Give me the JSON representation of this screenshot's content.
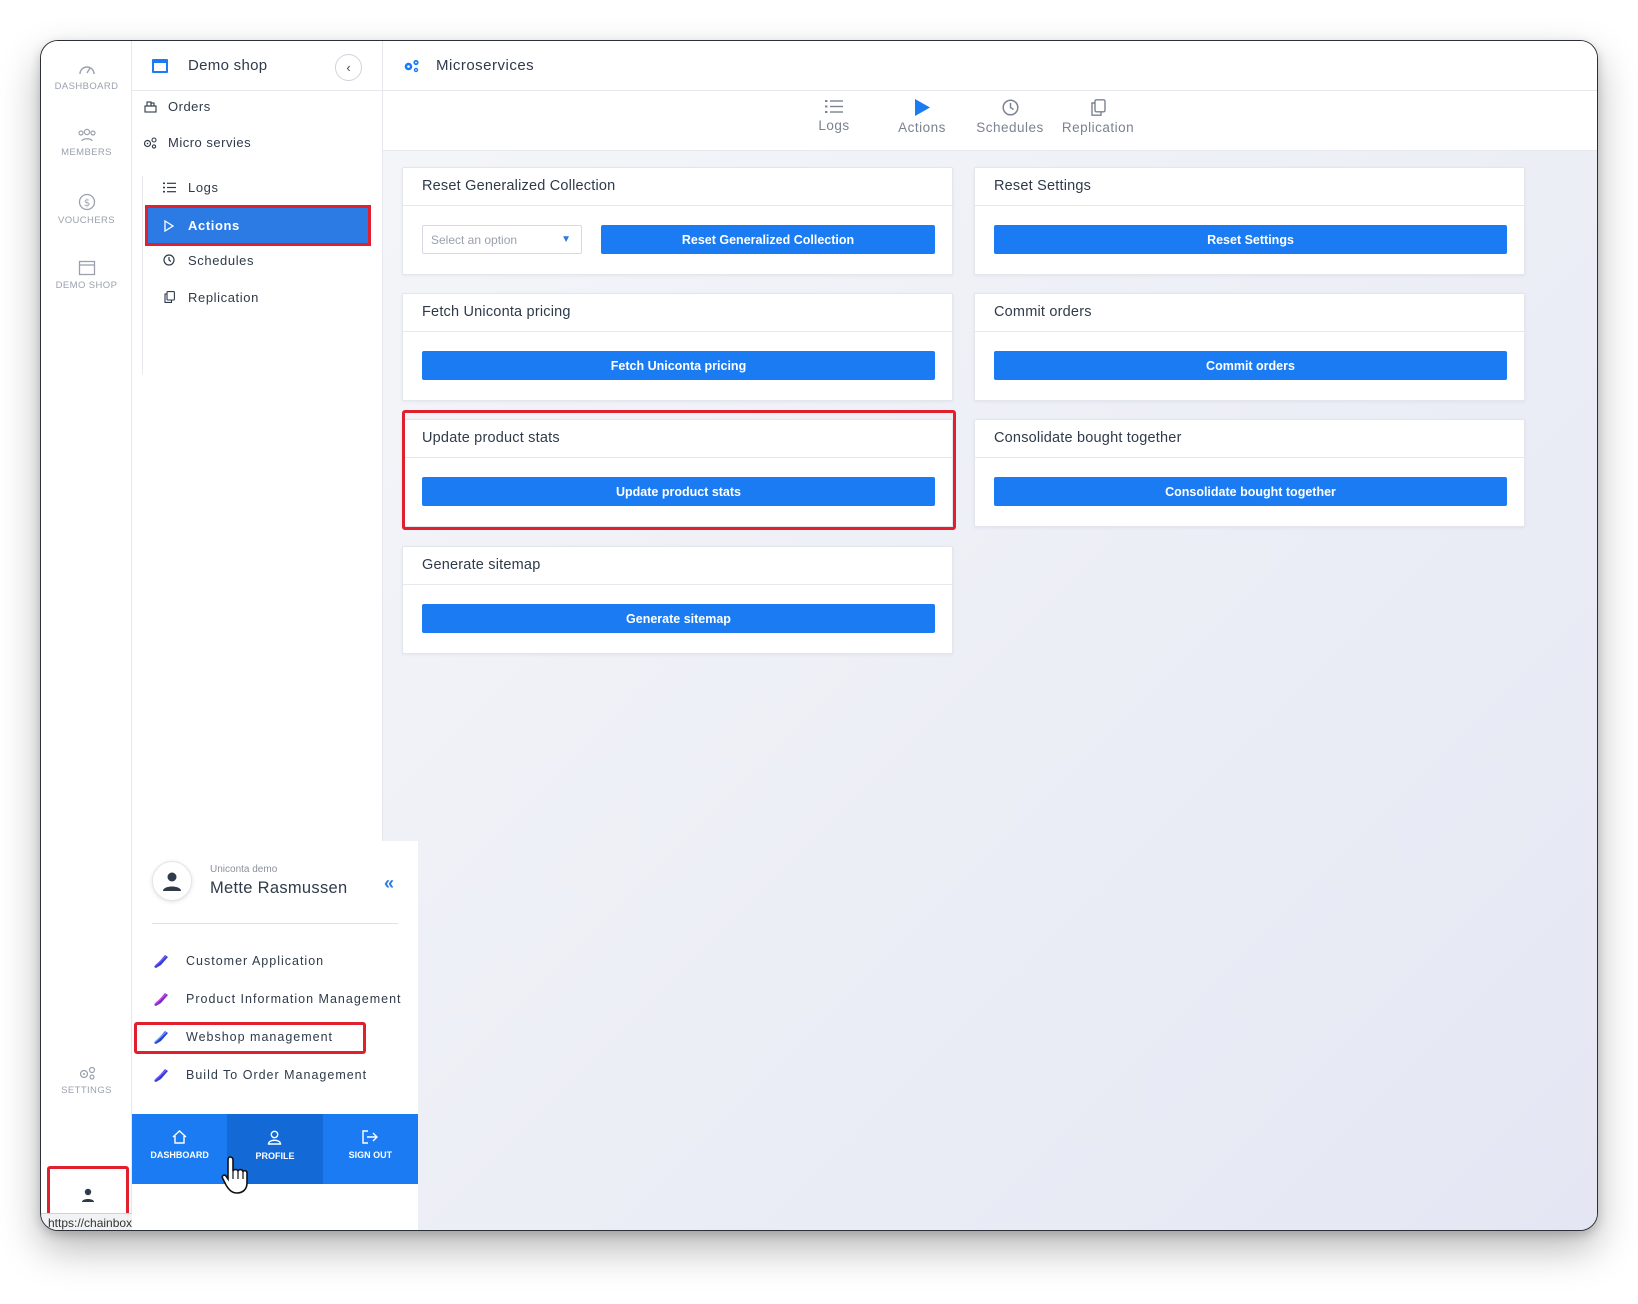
{
  "rail": {
    "items": [
      {
        "label": "DASHBOARD",
        "icon": "gauge-icon"
      },
      {
        "label": "MEMBERS",
        "icon": "members-icon"
      },
      {
        "label": "VOUCHERS",
        "icon": "dollar-circle-icon"
      },
      {
        "label": "DEMO SHOP",
        "icon": "window-icon"
      }
    ],
    "settings_label": "SETTINGS",
    "status_url": "https://chainbox.io"
  },
  "sidenav": {
    "title": "Demo shop",
    "items": [
      {
        "label": "Orders",
        "icon": "orders-icon"
      },
      {
        "label": "Micro servies",
        "icon": "cogs-icon"
      }
    ],
    "subitems": [
      {
        "label": "Logs",
        "icon": "list-icon"
      },
      {
        "label": "Actions",
        "icon": "play-icon",
        "active": true
      },
      {
        "label": "Schedules",
        "icon": "clock-icon"
      },
      {
        "label": "Replication",
        "icon": "copy-icon"
      }
    ]
  },
  "main": {
    "title": "Microservices",
    "tabs": [
      {
        "label": "Logs",
        "icon": "list-icon"
      },
      {
        "label": "Actions",
        "icon": "play-icon",
        "active": true
      },
      {
        "label": "Schedules",
        "icon": "clock-icon"
      },
      {
        "label": "Replication",
        "icon": "copy-icon"
      }
    ],
    "cards": [
      {
        "title": "Reset Generalized Collection",
        "button": "Reset Generalized Collection",
        "select_placeholder": "Select an option"
      },
      {
        "title": "Reset Settings",
        "button": "Reset Settings"
      },
      {
        "title": "Fetch Uniconta pricing",
        "button": "Fetch Uniconta pricing"
      },
      {
        "title": "Commit orders",
        "button": "Commit orders"
      },
      {
        "title": "Update product stats",
        "button": "Update product stats"
      },
      {
        "title": "Consolidate bought together",
        "button": "Consolidate bought together"
      },
      {
        "title": "Generate sitemap",
        "button": "Generate sitemap"
      }
    ]
  },
  "popup": {
    "org": "Uniconta demo",
    "user": "Mette Rasmussen",
    "apps": [
      {
        "label": "Customer Application"
      },
      {
        "label": "Product Information Management"
      },
      {
        "label": "Webshop management"
      },
      {
        "label": "Build To Order Management"
      }
    ],
    "footer": [
      {
        "label": "DASHBOARD",
        "icon": "home-icon"
      },
      {
        "label": "PROFILE",
        "icon": "user-icon"
      },
      {
        "label": "SIGN OUT",
        "icon": "sign-out-icon"
      }
    ]
  },
  "colors": {
    "accent": "#1a7bf2",
    "highlight": "#e0202e",
    "active_nav": "#2c7be5"
  }
}
